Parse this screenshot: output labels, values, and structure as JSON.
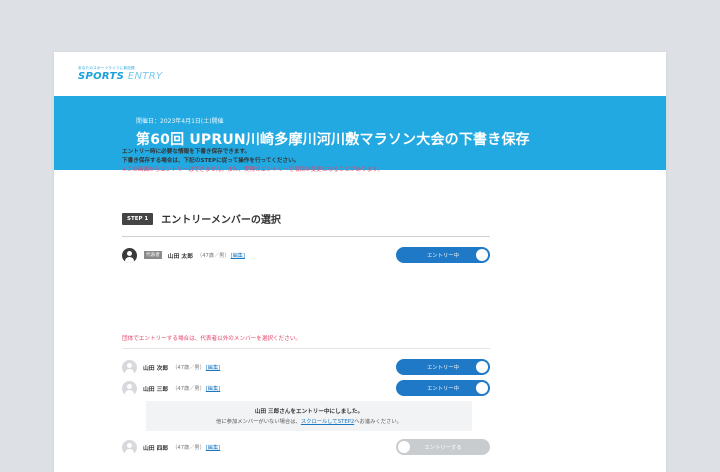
{
  "logo": {
    "tagline": "あなたのスポーツライフに新記録",
    "word1": "SPORTS",
    "word2": "ENTRY"
  },
  "hero": {
    "date": "開催日：2023年4月1日(土)開催",
    "title": "第60回 UPRUN川崎多摩川河川敷マラソン大会の下書き保存"
  },
  "intro": {
    "line1": "エントリー時に必要な情報を下書き保存できます。",
    "line2": "下書き保存する場合は、下記のSTEPに従って操作を行ってください。",
    "warning": "※この画面からエントリーはできません。また、実際のエントリーで項目が変更になることがあります。"
  },
  "step": {
    "badge": "STEP 1",
    "title": "エントリーメンバーの選択"
  },
  "representative": {
    "badge": "代表者",
    "name": "山田 太郎",
    "meta": "（47歳／男）",
    "edit": "[編集]",
    "toggle": "エントリー中"
  },
  "group_note": "団体でエントリーする場合は、代表者以外のメンバーを選択ください。",
  "members": [
    {
      "name": "山田 次郎",
      "meta": "（47歳／男）",
      "edit": "[編集]",
      "toggle": "エントリー中",
      "state": "on"
    },
    {
      "name": "山田 三郎",
      "meta": "（47歳／男）",
      "edit": "[編集]",
      "toggle": "エントリー中",
      "state": "on"
    },
    {
      "name": "山田 四郎",
      "meta": "（47歳／男）",
      "edit": "[編集]",
      "toggle": "エントリーする",
      "state": "off"
    }
  ],
  "info": {
    "title": "山田 三郎さんをエントリー中にしました。",
    "sub_before": "他に参加メンバーがいない場合は、",
    "sub_link": "スクロールしてSTEP2",
    "sub_after": "へお進みください。"
  },
  "colors": {
    "hero": "#23a9e1",
    "toggle_on": "#1f79c6",
    "toggle_off": "#c9cccf",
    "warning": "#e0456a",
    "link": "#1a78c2"
  }
}
